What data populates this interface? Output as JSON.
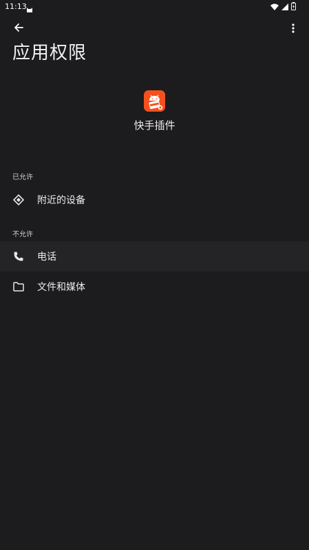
{
  "status_bar": {
    "time": "11:13",
    "left_icon": "cat-notification-icon",
    "right_icons": [
      "wifi-icon",
      "signal-icon",
      "battery-icon"
    ]
  },
  "app_bar": {
    "back_icon": "arrow-back-icon",
    "more_icon": "more-vert-icon",
    "title": "应用权限"
  },
  "app": {
    "icon": "app-android-icon",
    "name": "快手插件",
    "icon_color": "#f4511e"
  },
  "sections": {
    "allowed": {
      "label": "已允许",
      "items": [
        {
          "label": "附近的设备",
          "icon": "nearby-devices-icon"
        }
      ]
    },
    "denied": {
      "label": "不允许",
      "items": [
        {
          "label": "电话",
          "icon": "phone-icon"
        },
        {
          "label": "文件和媒体",
          "icon": "folder-icon"
        }
      ]
    }
  },
  "colors": {
    "background": "#1c1c1e",
    "row_highlight": "#242426",
    "text_primary": "#ececee",
    "text_secondary": "#d0d0d4"
  }
}
